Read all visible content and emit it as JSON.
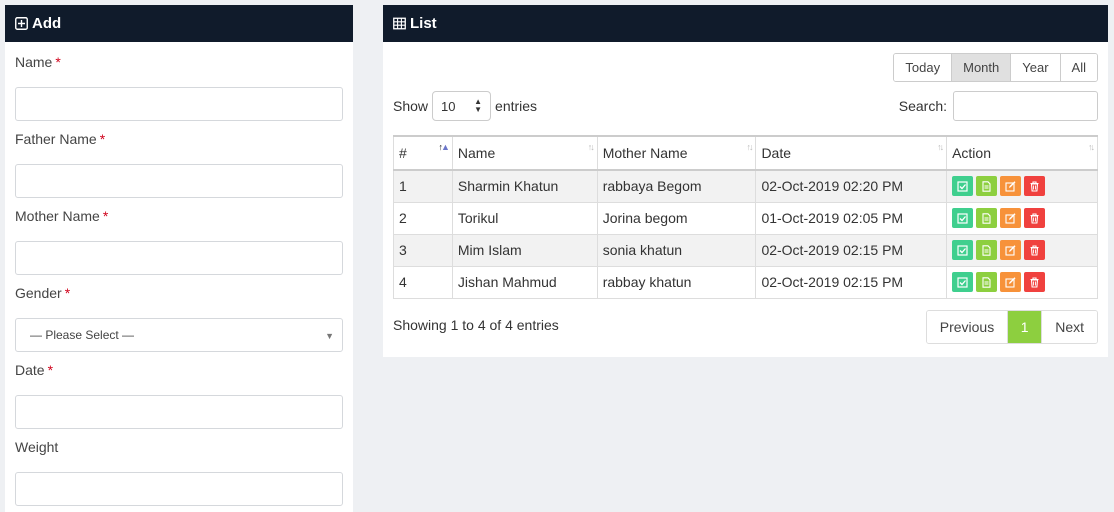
{
  "add_panel": {
    "title": "Add",
    "required_mark": "*",
    "fields": {
      "name": {
        "label": "Name",
        "value": ""
      },
      "father_name": {
        "label": "Father Name",
        "value": ""
      },
      "mother_name": {
        "label": "Mother Name",
        "value": ""
      },
      "gender": {
        "label": "Gender",
        "selected": "— Please Select —"
      },
      "date": {
        "label": "Date",
        "value": ""
      },
      "weight": {
        "label": "Weight",
        "value": ""
      }
    }
  },
  "list_panel": {
    "title": "List",
    "filters": [
      "Today",
      "Month",
      "Year",
      "All"
    ],
    "active_filter": "Month",
    "show_label": "Show",
    "entries_label": "entries",
    "page_length": "10",
    "search_label": "Search:",
    "search_value": "",
    "columns": [
      "#",
      "Name",
      "Mother Name",
      "Date",
      "Action"
    ],
    "rows": [
      {
        "num": "1",
        "name": "Sharmin Khatun",
        "mother": "rabbaya Begom",
        "date": "02-Oct-2019 02:20 PM"
      },
      {
        "num": "2",
        "name": "Torikul",
        "mother": "Jorina begom",
        "date": "01-Oct-2019 02:05 PM"
      },
      {
        "num": "3",
        "name": "Mim Islam",
        "mother": "sonia khatun",
        "date": "02-Oct-2019 02:15 PM"
      },
      {
        "num": "4",
        "name": "Jishan Mahmud",
        "mother": "rabbay khatun",
        "date": "02-Oct-2019 02:15 PM"
      }
    ],
    "row_action_icons": [
      "check-square-icon",
      "document-icon",
      "edit-icon",
      "trash-icon"
    ],
    "info": "Showing 1 to 4 of 4 entries",
    "pagination": {
      "previous": "Previous",
      "current": "1",
      "next": "Next"
    }
  },
  "colors": {
    "header_bg": "#101b2b",
    "action_check": "#3fcf8e",
    "action_doc": "#8dcf3f",
    "action_edit": "#f7923a",
    "action_delete": "#f0413e",
    "page_current": "#8dcf3f"
  }
}
